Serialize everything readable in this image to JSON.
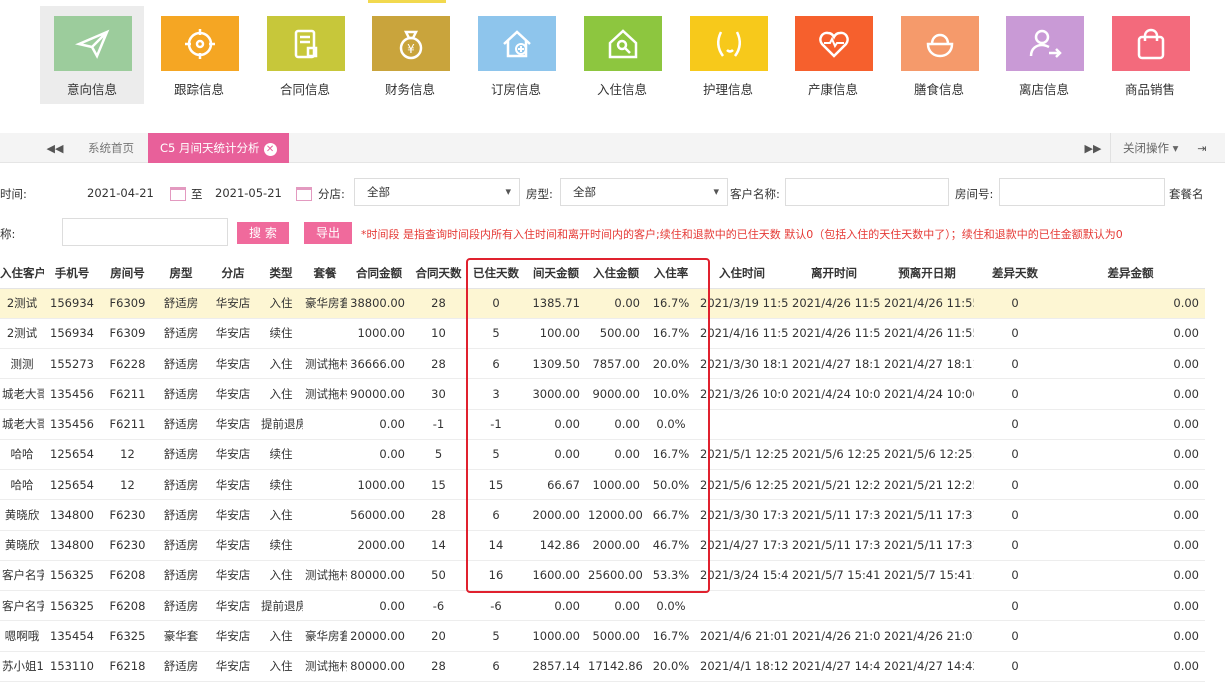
{
  "topnav": {
    "items": [
      {
        "label": "意向信息",
        "color": "#9ccc9c",
        "icon": "paper-plane-icon"
      },
      {
        "label": "跟踪信息",
        "color": "#f5a623",
        "icon": "target-icon"
      },
      {
        "label": "合同信息",
        "color": "#c7c73a",
        "icon": "contract-icon"
      },
      {
        "label": "财务信息",
        "color": "#c9a43c",
        "icon": "money-bag-icon"
      },
      {
        "label": "订房信息",
        "color": "#8ec5ec",
        "icon": "house-add-icon"
      },
      {
        "label": "入住信息",
        "color": "#8dc63f",
        "icon": "house-key-icon"
      },
      {
        "label": "护理信息",
        "color": "#f7c91b",
        "icon": "care-icon"
      },
      {
        "label": "产康信息",
        "color": "#f6602d",
        "icon": "heart-pulse-icon"
      },
      {
        "label": "膳食信息",
        "color": "#f59a6b",
        "icon": "rice-bowl-icon"
      },
      {
        "label": "离店信息",
        "color": "#c99ad6",
        "icon": "user-leave-icon"
      },
      {
        "label": "商品销售",
        "color": "#f36a7c",
        "icon": "shopping-bag-icon"
      }
    ]
  },
  "tabs": {
    "home": "系统首页",
    "active": "C5 月间天统计分析",
    "close_ops": "关闭操作"
  },
  "filters": {
    "time_label": "时间:",
    "date_from": "2021-04-21",
    "to_label": "至",
    "date_to": "2021-05-21",
    "branch_label": "分店:",
    "branch_value": "全部",
    "room_type_label": "房型:",
    "room_type_value": "全部",
    "customer_label": "客户名称:",
    "room_no_label": "房间号:",
    "package_label_a": "套餐名",
    "package_label_b": "称:",
    "search_btn": "搜 索",
    "export_btn": "导出",
    "note": "*时间段 是指查询时间段内所有入住时间和离开时间内的客户;续住和退款中的已住天数 默认0（包括入住的天住天数中了）；续住和退款中的已住金额默认为0"
  },
  "table": {
    "headers": [
      "入住客户",
      "手机号",
      "房间号",
      "房型",
      "分店",
      "类型",
      "套餐",
      "合同金额",
      "合同天数",
      "已住天数",
      "间天金额",
      "入住金额",
      "入住率",
      "入住时间",
      "离开时间",
      "预离开日期",
      "差异天数",
      "差异金额"
    ],
    "rows": [
      [
        "2测试",
        "156934",
        "F6309",
        "舒适房",
        "华安店",
        "入住",
        "豪华房套",
        "38800.00",
        "28",
        "0",
        "1385.71",
        "0.00",
        "16.7%",
        "2021/3/19 11:55",
        "2021/4/26 11:55",
        "2021/4/26 11:55",
        "0",
        "0.00"
      ],
      [
        "2测试",
        "156934",
        "F6309",
        "舒适房",
        "华安店",
        "续住",
        "",
        "1000.00",
        "10",
        "5",
        "100.00",
        "500.00",
        "16.7%",
        "2021/4/16 11:55",
        "2021/4/26 11:55",
        "2021/4/26 11:55",
        "0",
        "0.00"
      ],
      [
        "测测",
        "155273",
        "F6228",
        "舒适房",
        "华安店",
        "入住",
        "测试拖村",
        "36666.00",
        "28",
        "6",
        "1309.50",
        "7857.00",
        "20.0%",
        "2021/3/30 18:11",
        "2021/4/27 18:11",
        "2021/4/27 18:11",
        "0",
        "0.00"
      ],
      [
        "城老大哥",
        "135456",
        "F6211",
        "舒适房",
        "华安店",
        "入住",
        "测试拖村",
        "90000.00",
        "30",
        "3",
        "3000.00",
        "9000.00",
        "10.0%",
        "2021/3/26 10:06",
        "2021/4/24 10:06",
        "2021/4/24 10:06",
        "0",
        "0.00"
      ],
      [
        "城老大哥",
        "135456",
        "F6211",
        "舒适房",
        "华安店",
        "提前退房",
        "",
        "0.00",
        "-1",
        "-1",
        "0.00",
        "0.00",
        "0.0%",
        "",
        "",
        "",
        "0",
        "0.00"
      ],
      [
        "哈哈",
        "125654",
        "12",
        "舒适房",
        "华安店",
        "续住",
        "",
        "0.00",
        "5",
        "5",
        "0.00",
        "0.00",
        "16.7%",
        "2021/5/1 12:25:1",
        "2021/5/6 12:25:1",
        "2021/5/6 12:25:1",
        "0",
        "0.00"
      ],
      [
        "哈哈",
        "125654",
        "12",
        "舒适房",
        "华安店",
        "续住",
        "",
        "1000.00",
        "15",
        "15",
        "66.67",
        "1000.00",
        "50.0%",
        "2021/5/6 12:25:1",
        "2021/5/21 12:25",
        "2021/5/21 12:25",
        "0",
        "0.00"
      ],
      [
        "黄晓欣",
        "134800",
        "F6230",
        "舒适房",
        "华安店",
        "入住",
        "",
        "56000.00",
        "28",
        "6",
        "2000.00",
        "12000.00",
        "66.7%",
        "2021/3/30 17:31",
        "2021/5/11 17:31",
        "2021/5/11 17:31",
        "0",
        "0.00"
      ],
      [
        "黄晓欣",
        "134800",
        "F6230",
        "舒适房",
        "华安店",
        "续住",
        "",
        "2000.00",
        "14",
        "14",
        "142.86",
        "2000.00",
        "46.7%",
        "2021/4/27 17:31",
        "2021/5/11 17:31",
        "2021/5/11 17:31",
        "0",
        "0.00"
      ],
      [
        "客户名字",
        "156325",
        "F6208",
        "舒适房",
        "华安店",
        "入住",
        "测试拖村",
        "80000.00",
        "50",
        "16",
        "1600.00",
        "25600.00",
        "53.3%",
        "2021/3/24 15:41",
        "2021/5/7 15:41:1",
        "2021/5/7 15:41:1",
        "0",
        "0.00"
      ],
      [
        "客户名字",
        "156325",
        "F6208",
        "舒适房",
        "华安店",
        "提前退房",
        "",
        "0.00",
        "-6",
        "-6",
        "0.00",
        "0.00",
        "0.0%",
        "",
        "",
        "",
        "0",
        "0.00"
      ],
      [
        "嗯啊哦",
        "135454",
        "F6325",
        "豪华套",
        "华安店",
        "入住",
        "豪华房套",
        "20000.00",
        "20",
        "5",
        "1000.00",
        "5000.00",
        "16.7%",
        "2021/4/6 21:01:4",
        "2021/4/26 21:01",
        "2021/4/26 21:01",
        "0",
        "0.00"
      ],
      [
        "苏小姐11",
        "153110",
        "F6218",
        "舒适房",
        "华安店",
        "入住",
        "测试拖村",
        "80000.00",
        "28",
        "6",
        "2857.14",
        "17142.86",
        "20.0%",
        "2021/4/1 18:12:1",
        "2021/4/27 14:42",
        "2021/4/27 14:42",
        "0",
        "0.00"
      ]
    ]
  }
}
